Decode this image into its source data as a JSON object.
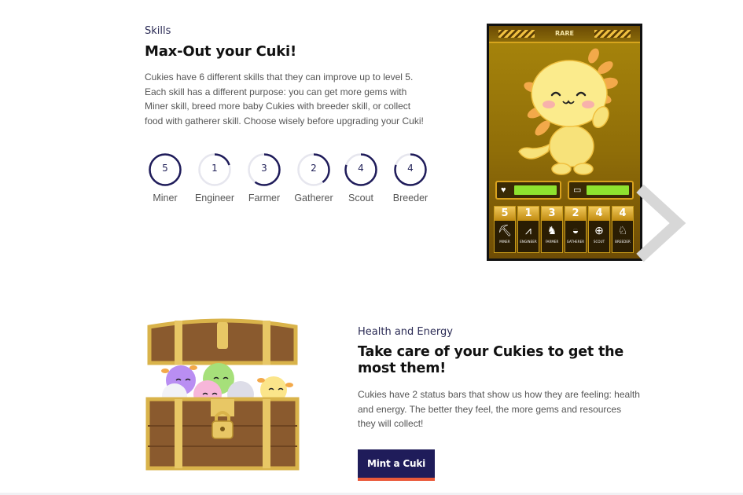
{
  "skills_section": {
    "eyebrow": "Skills",
    "heading": "Max-Out your Cuki!",
    "paragraph": "Cukies have 6 different skills that they can improve up to level 5. Each skill has a different purpose: you can get more gems with Miner skill, breed more baby Cukies with breeder skill, or collect food with gatherer skill. Choose wisely before upgrading your Cuki!",
    "max_level": 5,
    "skills": [
      {
        "name": "Miner",
        "level": "5"
      },
      {
        "name": "Engineer",
        "level": "1"
      },
      {
        "name": "Farmer",
        "level": "3"
      },
      {
        "name": "Gatherer",
        "level": "2"
      },
      {
        "name": "Scout",
        "level": "4"
      },
      {
        "name": "Breeder",
        "level": "4"
      }
    ]
  },
  "card": {
    "rarity": "RARE",
    "health_icon": "heart-pulse-icon",
    "energy_icon": "battery-icon",
    "health_level": 1.0,
    "energy_level": 1.0,
    "stats": [
      {
        "level": "5",
        "label": "MINER",
        "icon": "pickaxe-icon"
      },
      {
        "level": "1",
        "label": "ENGINEER",
        "icon": "compass-tool-icon"
      },
      {
        "level": "3",
        "label": "FARMER",
        "icon": "cow-icon"
      },
      {
        "level": "2",
        "label": "GATHERER",
        "icon": "basket-icon"
      },
      {
        "level": "4",
        "label": "SCOUT",
        "icon": "compass-icon"
      },
      {
        "level": "4",
        "label": "BREEDER",
        "icon": "rocking-horse-icon"
      }
    ]
  },
  "health_section": {
    "eyebrow": "Health and Energy",
    "heading": "Take care of your Cukies to get the most them!",
    "paragraph": "Cukies have 2 status bars that show us how they are feeling: health and energy. The better they feel, the more gems and resources they will collect!",
    "cta_label": "Mint a Cuki"
  },
  "colors": {
    "ring": "#1f1c5a",
    "ring_track": "#e6e6ee",
    "button_bg": "#1f1c5a",
    "button_accent": "#ea5a3a",
    "card_gold": "#a8860c",
    "bar_fill": "#8ee32f"
  }
}
